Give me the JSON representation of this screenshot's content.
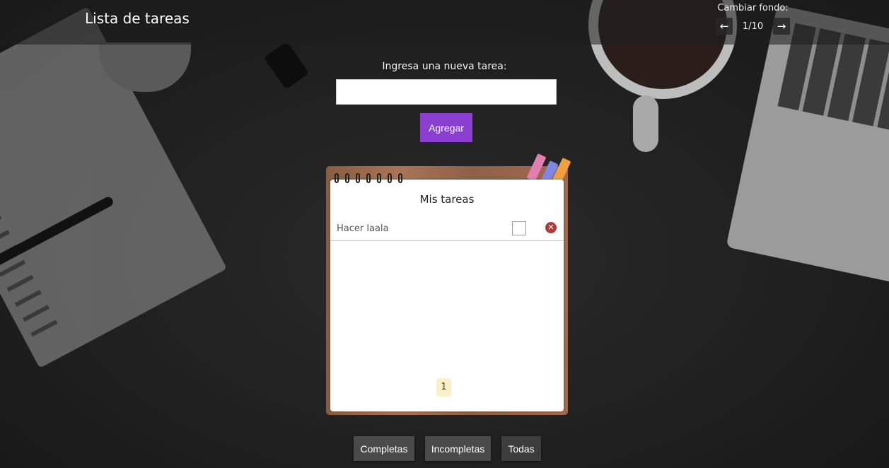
{
  "header": {
    "title": "Lista de tareas",
    "background_switch": {
      "label": "Cambiar fondo:",
      "prev": "←",
      "counter": "1/10",
      "next": "→"
    }
  },
  "form": {
    "label": "Ingresa una nueva tarea:",
    "input_value": "",
    "input_placeholder": "",
    "add_button": "Agregar"
  },
  "notepad": {
    "title": "Mis tareas",
    "tasks": [
      {
        "text": "Hacer laala",
        "completed": false,
        "delete_icon": "close-circle-icon"
      }
    ],
    "pagination": {
      "current_page": "1"
    }
  },
  "filters": {
    "completed": "Completas",
    "incomplete": "Incompletas",
    "all": "Todas"
  },
  "colors": {
    "accent": "#8a3fd1",
    "delete": "#b03a3a",
    "page_highlight": "#fbefc6"
  }
}
